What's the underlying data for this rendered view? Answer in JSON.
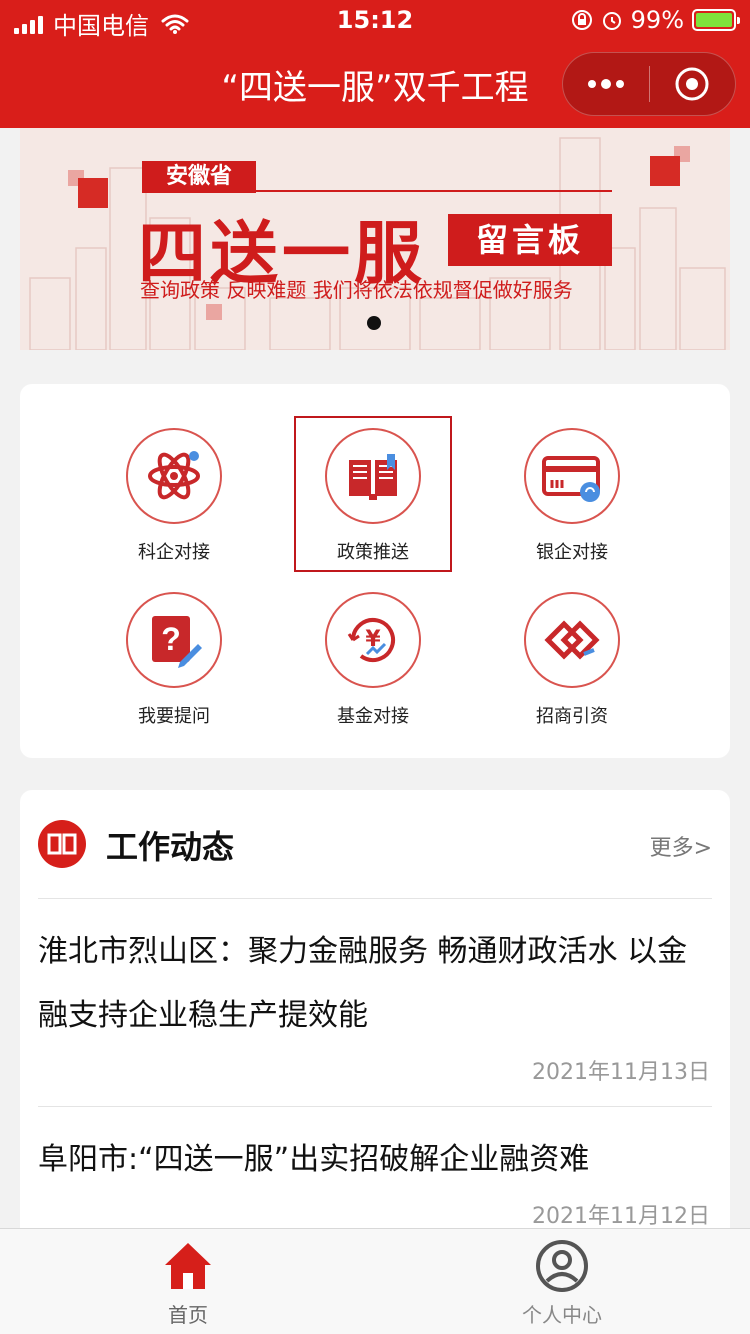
{
  "status_bar": {
    "carrier": "中国电信",
    "time": "15:12",
    "battery": "99%"
  },
  "nav": {
    "title": "“四送一服”双千工程"
  },
  "banner": {
    "tag": "安徽省",
    "title": "四送一服",
    "board": "留言板",
    "subtitle": "查询政策 反映难题 我们将依法依规督促做好服务"
  },
  "menu": {
    "items": [
      {
        "label": "科企对接",
        "icon": "atom-icon"
      },
      {
        "label": "政策推送",
        "icon": "book-icon"
      },
      {
        "label": "银企对接",
        "icon": "bank-card-icon"
      },
      {
        "label": "我要提问",
        "icon": "question-note-icon"
      },
      {
        "label": "基金对接",
        "icon": "yuan-coin-icon"
      },
      {
        "label": "招商引资",
        "icon": "handshake-icon"
      }
    ]
  },
  "news": {
    "title": "工作动态",
    "more": "更多>",
    "items": [
      {
        "title": "淮北市烈山区：聚力金融服务 畅通财政活水 以金融支持企业稳生产提效能",
        "date": "2021年11月13日"
      },
      {
        "title": "阜阳市:“四送一服”出实招破解企业融资难",
        "date": "2021年11月12日"
      }
    ]
  },
  "tabbar": {
    "tabs": [
      {
        "label": "首页",
        "icon": "home-icon",
        "active_color": "#d61f1a"
      },
      {
        "label": "个人中心",
        "icon": "user-icon"
      }
    ]
  },
  "colors": {
    "primary": "#d91e1a",
    "accent_border": "#c0181c"
  }
}
